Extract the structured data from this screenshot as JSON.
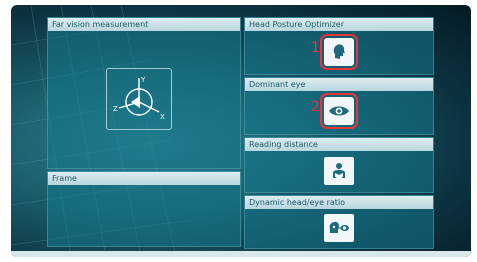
{
  "panels": {
    "far_vision": {
      "label": "Far vision measurement"
    },
    "frame": {
      "label": "Frame"
    },
    "head_posture": {
      "label": "Head Posture Optimizer",
      "marker": "1",
      "icon": "head-icon"
    },
    "dominant_eye": {
      "label": "Dominant eye",
      "marker": "2",
      "icon": "eye-icon"
    },
    "reading_distance": {
      "label": "Reading distance",
      "icon": "reading-person-icon"
    },
    "head_eye_ratio": {
      "label": "Dynamic head/eye ratio",
      "icon": "head-eye-icon"
    }
  },
  "axes_labels": {
    "y": "Y",
    "x": "X",
    "z": "Z"
  },
  "colors": {
    "highlight": "#e8343b",
    "header_text": "#1d5a68",
    "panel_bg": "#14788c",
    "icon_bg": "#f2f7f9"
  }
}
